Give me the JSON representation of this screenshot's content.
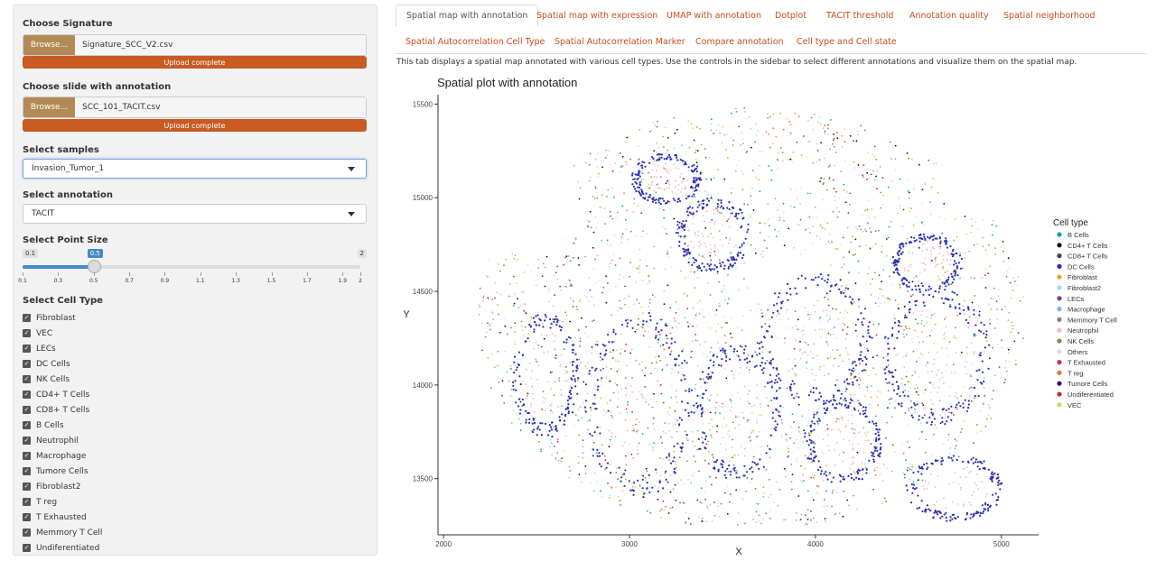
{
  "sidebar": {
    "signature": {
      "label": "Choose Signature",
      "browse": "Browse...",
      "file": "Signature_SCC_V2.csv",
      "status": "Upload complete"
    },
    "slide": {
      "label": "Choose slide with annotation",
      "browse": "Browse...",
      "file": "SCC_101_TACIT.csv",
      "status": "Upload complete"
    },
    "samples": {
      "label": "Select samples",
      "value": "Invasion_Tumor_1"
    },
    "annotation": {
      "label": "Select annotation",
      "value": "TACIT"
    },
    "point_size": {
      "label": "Select Point Size",
      "min_label": "0.1",
      "max_label": "2",
      "value_label": "0.5",
      "value": 0.5,
      "min": 0.1,
      "max": 2,
      "ticks": [
        "0.1",
        "0.3",
        "0.5",
        "0.7",
        "0.9",
        "1.1",
        "1.3",
        "1.5",
        "1.7",
        "1.9",
        "2"
      ]
    },
    "cell_type": {
      "label": "Select Cell Type",
      "items": [
        "Fibroblast",
        "VEC",
        "LECs",
        "DC Cells",
        "NK Cells",
        "CD4+ T Cells",
        "CD8+ T Cells",
        "B Cells",
        "Neutrophil",
        "Macrophage",
        "Tumore Cells",
        "Fibroblast2",
        "T reg",
        "T Exhausted",
        "Memmory T Cell",
        "Undiferentiated"
      ]
    }
  },
  "tabs": [
    {
      "label": "Spatial map with annotation",
      "active": true
    },
    {
      "label": "Spatial map with expression"
    },
    {
      "label": "UMAP with annotation"
    },
    {
      "label": "Dotplot"
    },
    {
      "label": "TACIT threshold"
    },
    {
      "label": "Annotation quality"
    },
    {
      "label": "Spatial neighborhood"
    },
    {
      "label": "Spatial Autocorrelation Cell Type"
    },
    {
      "label": "Spatial Autocorrelation Marker"
    },
    {
      "label": "Compare annotation"
    },
    {
      "label": "Cell type and Cell state"
    }
  ],
  "description": "This tab displays a spatial map annotated with various cell types. Use the controls in the sidebar to select different annotations and visualize them on the spatial map.",
  "chart_data": {
    "type": "scatter",
    "title": "Spatial plot with annotation",
    "xlabel": "X",
    "ylabel": "Y",
    "xlim": [
      1970,
      5200
    ],
    "ylim": [
      13200,
      15550
    ],
    "xticks": [
      2000,
      3000,
      4000,
      5000
    ],
    "yticks": [
      13500,
      14000,
      14500,
      15000,
      15500
    ],
    "grid": false,
    "legend_title": "Cell type",
    "legend_position": "right",
    "legend": [
      {
        "name": "B Cells",
        "color": "#1b9e9e"
      },
      {
        "name": "CD4+ T Cells",
        "color": "#111111"
      },
      {
        "name": "CD8+ T Cells",
        "color": "#444444"
      },
      {
        "name": "DC Cells",
        "color": "#2b2fb3"
      },
      {
        "name": "Fibroblast",
        "color": "#e0a82e"
      },
      {
        "name": "Fibroblast2",
        "color": "#a6d7f0"
      },
      {
        "name": "LECs",
        "color": "#6a3d9a"
      },
      {
        "name": "Macrophage",
        "color": "#7ab8d6"
      },
      {
        "name": "Memmory T Cell",
        "color": "#808080"
      },
      {
        "name": "Neutrophil",
        "color": "#f4b6c2"
      },
      {
        "name": "NK Cells",
        "color": "#8c8c3a"
      },
      {
        "name": "Others",
        "color": "#dddddd"
      },
      {
        "name": "T Exhausted",
        "color": "#b0413e"
      },
      {
        "name": "T reg",
        "color": "#d9774b"
      },
      {
        "name": "Tumore Cells",
        "color": "#1a1a6e"
      },
      {
        "name": "Undiferentiated",
        "color": "#c22b2b"
      },
      {
        "name": "VEC",
        "color": "#b5e65f"
      }
    ]
  }
}
